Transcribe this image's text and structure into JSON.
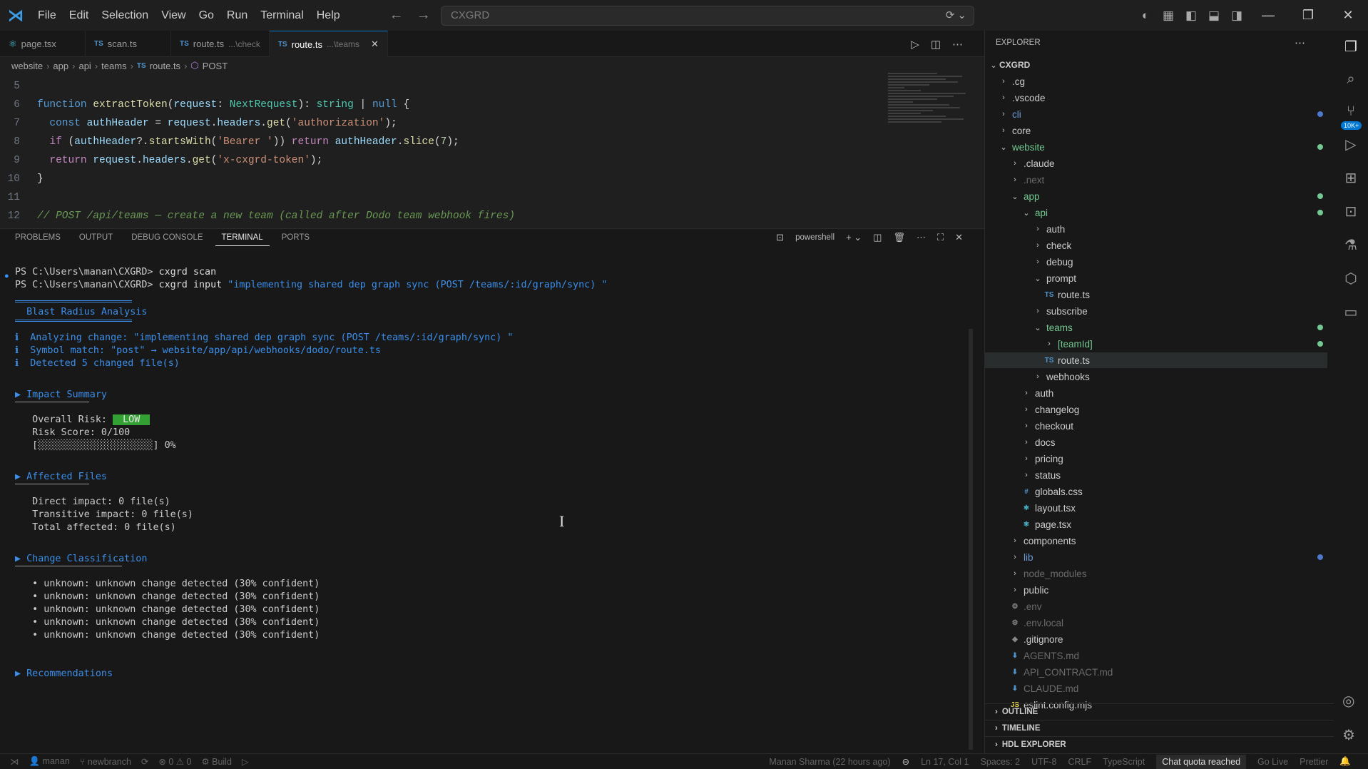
{
  "menu": [
    "File",
    "Edit",
    "Selection",
    "View",
    "Go",
    "Run",
    "Terminal",
    "Help"
  ],
  "command_center": "CXGRD",
  "tabs": [
    {
      "label": "page.tsx",
      "desc": "",
      "kind": "react"
    },
    {
      "label": "scan.ts",
      "desc": "",
      "kind": "TS"
    },
    {
      "label": "route.ts",
      "desc": "...\\check",
      "kind": "TS"
    },
    {
      "label": "route.ts",
      "desc": "...\\teams",
      "kind": "TS"
    }
  ],
  "breadcrumb": [
    "website",
    "app",
    "api",
    "teams",
    "route.ts",
    "POST"
  ],
  "code_lines": [
    {
      "n": "5",
      "html": ""
    },
    {
      "n": "6",
      "html": "<span class='kw'>function</span> <span class='fn'>extractToken</span>(<span class='var'>request</span>: <span class='ty'>NextRequest</span>): <span class='ty'>string</span> | <span class='kw'>null</span> {"
    },
    {
      "n": "7",
      "html": "  <span class='kw'>const</span> <span class='var'>authHeader</span> = <span class='var'>request</span>.<span class='var'>headers</span>.<span class='fn'>get</span>(<span class='str'>'authorization'</span>);"
    },
    {
      "n": "8",
      "html": "  <span class='kw2'>if</span> (<span class='var'>authHeader</span>?.<span class='fn'>startsWith</span>(<span class='str'>'Bearer '</span>)) <span class='kw2'>return</span> <span class='var'>authHeader</span>.<span class='fn'>slice</span>(<span class='nm'>7</span>);"
    },
    {
      "n": "9",
      "html": "  <span class='kw2'>return</span> <span class='var'>request</span>.<span class='var'>headers</span>.<span class='fn'>get</span>(<span class='str'>'x-cxgrd-token'</span>);"
    },
    {
      "n": "10",
      "html": "}"
    },
    {
      "n": "11",
      "html": ""
    },
    {
      "n": "12",
      "html": "<span class='cmt'>// POST /api/teams — create a new team (called after Dodo team webhook fires)</span>"
    }
  ],
  "panel_tabs": [
    "PROBLEMS",
    "OUTPUT",
    "DEBUG CONSOLE",
    "TERMINAL",
    "PORTS"
  ],
  "terminal_shell": "powershell",
  "terminal": {
    "l1_prompt": "PS C:\\Users\\manan\\CXGRD> ",
    "l1_cmd": "cxgrd scan",
    "l2_prompt": "PS C:\\Users\\manan\\CXGRD> ",
    "l2_cmd": "cxgrd input ",
    "l2_arg": "\"implementing shared dep graph sync (POST /teams/:id/graph/sync) \"",
    "title": "  Blast Radius Analysis",
    "info1": "ℹ  Analyzing change: \"implementing shared dep graph sync (POST /teams/:id/graph/sync) \"",
    "info2": "ℹ  Symbol match: \"post\" → website/app/api/webhooks/dodo/route.ts",
    "info3": "ℹ  Detected 5 changed file(s)",
    "sec1": "▶ Impact Summary",
    "risk_label": "   Overall Risk: ",
    "risk_value": " LOW ",
    "score": "   Risk Score: 0/100",
    "bar": "   [░░░░░░░░░░░░░░░░░░░░] 0%",
    "sec2": "▶ Affected Files",
    "direct": "   Direct impact: 0 file(s)",
    "transitive": "   Transitive impact: 0 file(s)",
    "total": "   Total affected: 0 file(s)",
    "sec3": "▶ Change Classification",
    "bullet": "   • unknown: unknown change detected (30% confident)",
    "sec4": "▶ Recommendations"
  },
  "explorer": {
    "title": "EXPLORER",
    "root": "CXGRD",
    "items": [
      {
        "label": ".cg",
        "depth": 0,
        "type": "folder",
        "open": false,
        "color": "#cccccc"
      },
      {
        "label": ".vscode",
        "depth": 0,
        "type": "folder",
        "open": false,
        "color": "#cccccc"
      },
      {
        "label": "cli",
        "depth": 0,
        "type": "folder",
        "open": false,
        "color": "#6b9bd6",
        "mod": "#4d78cc"
      },
      {
        "label": "core",
        "depth": 0,
        "type": "folder",
        "open": false,
        "color": "#cccccc"
      },
      {
        "label": "website",
        "depth": 0,
        "type": "folder",
        "open": true,
        "color": "#73c991",
        "mod": "#73c991"
      },
      {
        "label": ".claude",
        "depth": 1,
        "type": "folder",
        "open": false,
        "color": "#cccccc"
      },
      {
        "label": ".next",
        "depth": 1,
        "type": "folder",
        "open": false,
        "color": "#6b6b6b"
      },
      {
        "label": "app",
        "depth": 1,
        "type": "folder",
        "open": true,
        "color": "#73c991",
        "mod": "#73c991"
      },
      {
        "label": "api",
        "depth": 2,
        "type": "folder",
        "open": true,
        "color": "#73c991",
        "mod": "#73c991"
      },
      {
        "label": "auth",
        "depth": 3,
        "type": "folder",
        "open": false,
        "color": "#cccccc"
      },
      {
        "label": "check",
        "depth": 3,
        "type": "folder",
        "open": false,
        "color": "#cccccc"
      },
      {
        "label": "debug",
        "depth": 3,
        "type": "folder",
        "open": false,
        "color": "#cccccc"
      },
      {
        "label": "prompt",
        "depth": 3,
        "type": "folder",
        "open": true,
        "color": "#cccccc"
      },
      {
        "label": "route.ts",
        "depth": 4,
        "type": "ts",
        "color": "#cccccc"
      },
      {
        "label": "subscribe",
        "depth": 3,
        "type": "folder",
        "open": false,
        "color": "#cccccc"
      },
      {
        "label": "teams",
        "depth": 3,
        "type": "folder",
        "open": true,
        "color": "#73c991",
        "mod": "#73c991"
      },
      {
        "label": "[teamId]",
        "depth": 4,
        "type": "folder",
        "open": false,
        "color": "#73c991",
        "mod": "#73c991"
      },
      {
        "label": "route.ts",
        "depth": 4,
        "type": "ts",
        "color": "#cccccc",
        "selected": true
      },
      {
        "label": "webhooks",
        "depth": 3,
        "type": "folder",
        "open": false,
        "color": "#cccccc"
      },
      {
        "label": "auth",
        "depth": 2,
        "type": "folder",
        "open": false,
        "color": "#cccccc"
      },
      {
        "label": "changelog",
        "depth": 2,
        "type": "folder",
        "open": false,
        "color": "#cccccc"
      },
      {
        "label": "checkout",
        "depth": 2,
        "type": "folder",
        "open": false,
        "color": "#cccccc"
      },
      {
        "label": "docs",
        "depth": 2,
        "type": "folder",
        "open": false,
        "color": "#cccccc"
      },
      {
        "label": "pricing",
        "depth": 2,
        "type": "folder",
        "open": false,
        "color": "#cccccc"
      },
      {
        "label": "status",
        "depth": 2,
        "type": "folder",
        "open": false,
        "color": "#cccccc"
      },
      {
        "label": "globals.css",
        "depth": 2,
        "type": "css",
        "color": "#cccccc"
      },
      {
        "label": "layout.tsx",
        "depth": 2,
        "type": "react",
        "color": "#cccccc"
      },
      {
        "label": "page.tsx",
        "depth": 2,
        "type": "react",
        "color": "#cccccc"
      },
      {
        "label": "components",
        "depth": 1,
        "type": "folder",
        "open": false,
        "color": "#cccccc"
      },
      {
        "label": "lib",
        "depth": 1,
        "type": "folder",
        "open": false,
        "color": "#6b9bd6",
        "mod": "#4d78cc"
      },
      {
        "label": "node_modules",
        "depth": 1,
        "type": "folder",
        "open": false,
        "color": "#6b6b6b"
      },
      {
        "label": "public",
        "depth": 1,
        "type": "folder",
        "open": false,
        "color": "#cccccc"
      },
      {
        "label": ".env",
        "depth": 1,
        "type": "gear",
        "color": "#6b6b6b"
      },
      {
        "label": ".env.local",
        "depth": 1,
        "type": "gear",
        "color": "#6b6b6b"
      },
      {
        "label": ".gitignore",
        "depth": 1,
        "type": "git",
        "color": "#cccccc"
      },
      {
        "label": "AGENTS.md",
        "depth": 1,
        "type": "md",
        "color": "#6b6b6b"
      },
      {
        "label": "API_CONTRACT.md",
        "depth": 1,
        "type": "md",
        "color": "#6b6b6b"
      },
      {
        "label": "CLAUDE.md",
        "depth": 1,
        "type": "md",
        "color": "#6b6b6b"
      },
      {
        "label": "eslint.config.mjs",
        "depth": 1,
        "type": "js",
        "color": "#cccccc"
      }
    ],
    "outline": "OUTLINE",
    "timeline": "TIMELINE",
    "hdl": "HDL EXPLORER"
  },
  "activity_badge": "10K+",
  "status": {
    "branch": "manan",
    "branch2": "newbranch",
    "errors": "0",
    "warnings": "0",
    "build": "Build",
    "blame": "Manan Sharma (22 hours ago)",
    "pos": "Ln 17, Col 1",
    "spaces": "Spaces: 2",
    "enc": "UTF-8",
    "eol": "CRLF",
    "lang": "TypeScript",
    "quota": "Chat quota reached",
    "golive": "Go Live",
    "prettier": "Prettier"
  }
}
